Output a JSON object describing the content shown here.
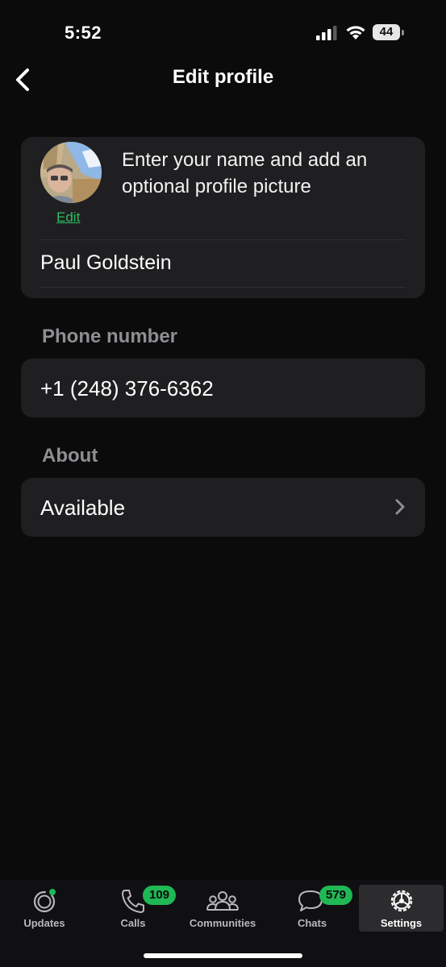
{
  "status_bar": {
    "time": "5:52",
    "battery_level": "44"
  },
  "header": {
    "title": "Edit profile"
  },
  "profile": {
    "edit_label": "Edit",
    "hint": "Enter your name and add an optional profile picture",
    "name": "Paul Goldstein"
  },
  "phone": {
    "section_label": "Phone number",
    "value": "+1 (248) 376-6362"
  },
  "about": {
    "section_label": "About",
    "value": "Available"
  },
  "tabs": [
    {
      "label": "Updates",
      "icon": "updates-icon",
      "badge": ""
    },
    {
      "label": "Calls",
      "icon": "phone-icon",
      "badge": "109"
    },
    {
      "label": "Communities",
      "icon": "communities-icon",
      "badge": ""
    },
    {
      "label": "Chats",
      "icon": "chats-icon",
      "badge": "579"
    },
    {
      "label": "Settings",
      "icon": "gear-icon",
      "badge": ""
    }
  ],
  "colors": {
    "accent": "#2fbf63",
    "badge": "#1fb855",
    "background": "#0b0b0b",
    "card": "#1f1f21",
    "secondary_text": "#8e8e93"
  }
}
